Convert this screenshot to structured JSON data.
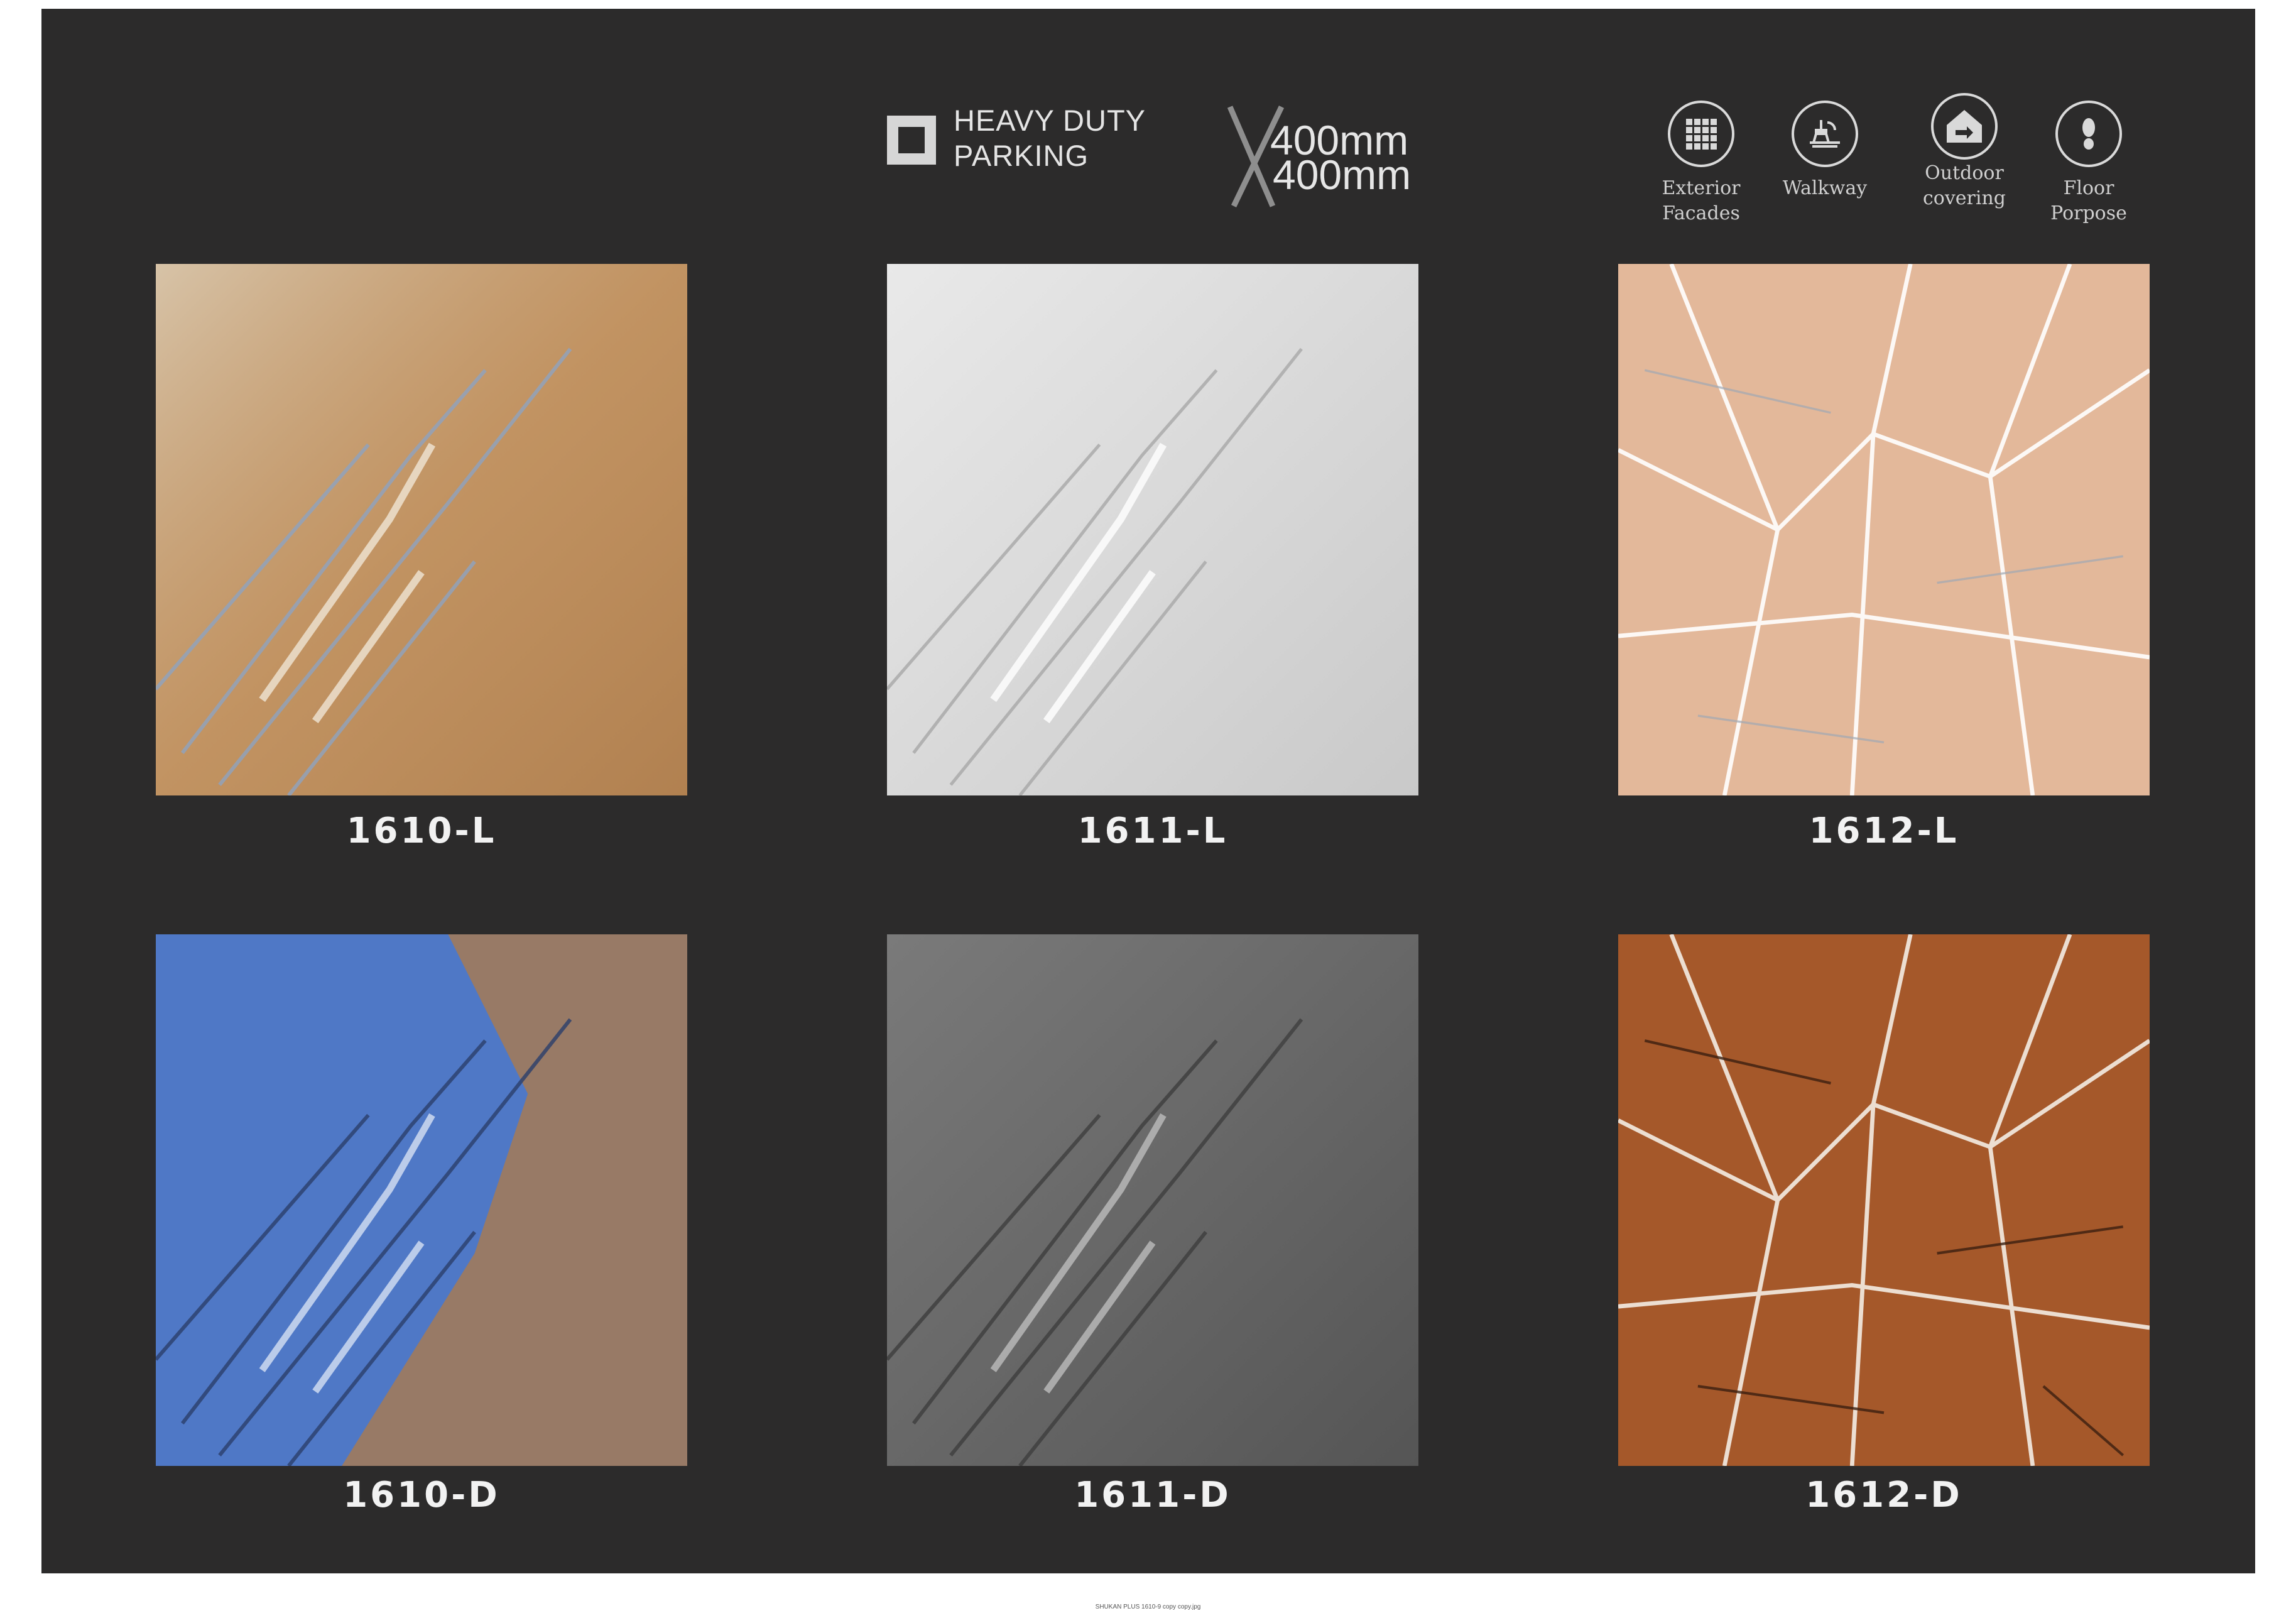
{
  "header": {
    "badge_line1": "HEAVY DUTY",
    "badge_line2": "PARKING",
    "size_top": "400mm",
    "size_bottom": "400mm"
  },
  "uses": [
    {
      "line1": "Exterior",
      "line2": "Facades",
      "icon": "grid-tile-icon"
    },
    {
      "line1": "Walkway",
      "line2": "",
      "icon": "walkway-icon"
    },
    {
      "line1": "Outdoor",
      "line2": "covering",
      "icon": "outdoor-covering-icon"
    },
    {
      "line1": "Floor",
      "line2": "Porpose",
      "icon": "footprint-icon"
    }
  ],
  "tiles": [
    {
      "code": "1610-L",
      "base": "#c9a57c",
      "vein": "#8fa3c0"
    },
    {
      "code": "1611-L",
      "base": "#dcdcdc",
      "vein": "#b9b9b9"
    },
    {
      "code": "1612-L",
      "base": "#e3b89a",
      "vein": "#ffffff"
    },
    {
      "code": "1610-D",
      "base": "#4d75c3",
      "vein": "#b07b45"
    },
    {
      "code": "1611-D",
      "base": "#6d6d6d",
      "vein": "#a3a3a3"
    },
    {
      "code": "1612-D",
      "base": "#a5582a",
      "vein": "#f4ede4"
    }
  ],
  "footer": {
    "filename": "SHUKAN PLUS 1610-9 copy copy.jpg"
  },
  "colors": {
    "background": "#2c2b2b",
    "text": "#f2f2f2"
  }
}
